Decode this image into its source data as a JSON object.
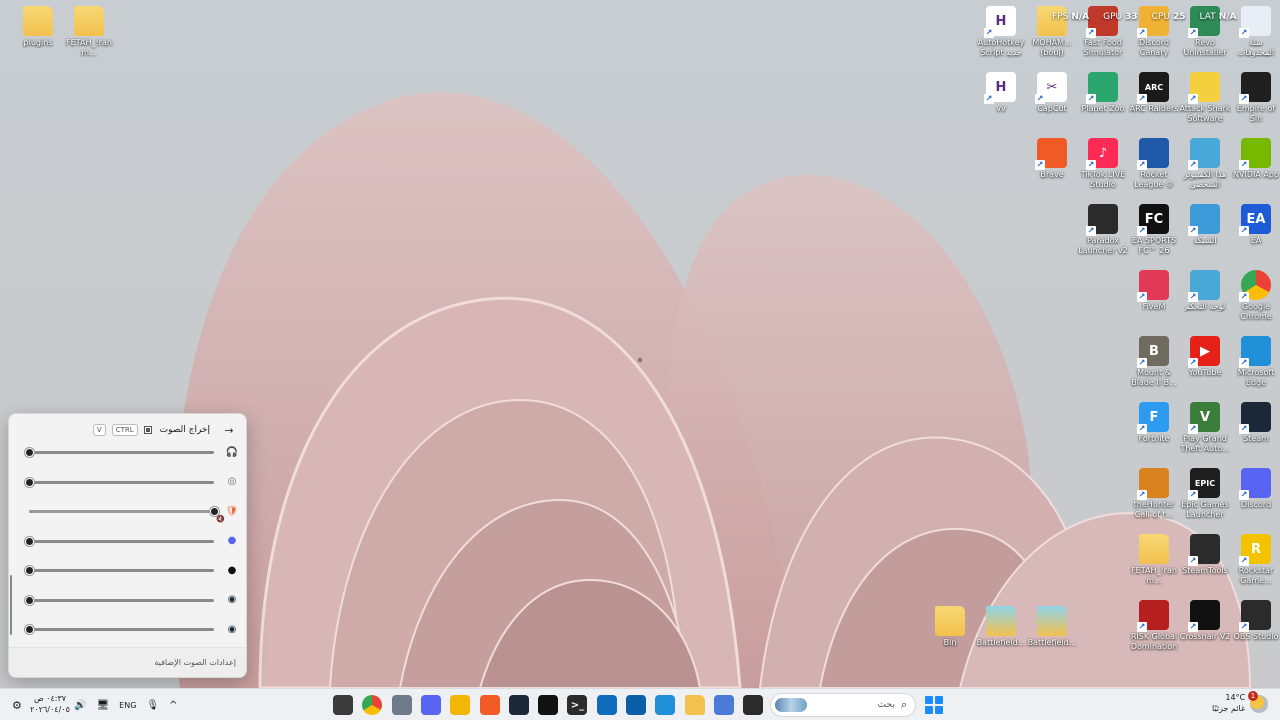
{
  "desktop": {
    "left_icons": [
      {
        "label": "plugins"
      },
      {
        "label": "FETAH_!ranm..."
      }
    ],
    "right_icons": [
      {
        "label": "AutoHotkey Script جديد",
        "glyph": "H",
        "color": "#ffffff"
      },
      {
        "label": "MOHAM... (bouj)",
        "glyph": "",
        "color": "folder"
      },
      {
        "label": "Fast Food Simulator",
        "glyph": "",
        "color": "#c0392b"
      },
      {
        "label": "Discord Canary",
        "glyph": "",
        "color": "#f0b232"
      },
      {
        "label": "Revo Uninstaller",
        "glyph": "",
        "color": "#2e8b57"
      },
      {
        "label": "سلة المحذوفات",
        "glyph": "",
        "color": "#e8eef5"
      },
      {
        "label": "vv",
        "glyph": "H",
        "color": "#ffffff"
      },
      {
        "label": "CapCut",
        "glyph": "✂",
        "color": "#ffffff"
      },
      {
        "label": "Planet Zoo",
        "glyph": "",
        "color": "#2ca66f"
      },
      {
        "label": "ARC Raiders",
        "glyph": "ARC",
        "color": "#1a1a1a"
      },
      {
        "label": "Attack Shark Software",
        "glyph": "",
        "color": "#f4d03f"
      },
      {
        "label": "Empire of Sin",
        "glyph": "",
        "color": "#1f1f1f"
      },
      {
        "label": "Brave",
        "glyph": "",
        "color": "#f15a24"
      },
      {
        "label": "TikTok LIVE Studio",
        "glyph": "♪",
        "color": "#fe2c55"
      },
      {
        "label": "Rocket League ®",
        "glyph": "",
        "color": "#1e5aa8"
      },
      {
        "label": "هذا الكمبيوتر الشخصي",
        "glyph": "",
        "color": "#4aa8d8"
      },
      {
        "label": "NVIDIA App",
        "glyph": "",
        "color": "#76b900"
      },
      {
        "label": "Paradox Launcher v2",
        "glyph": "",
        "color": "#2b2b2b"
      },
      {
        "label": "EA SPORTS FC™ 26",
        "glyph": "FC",
        "color": "#111111"
      },
      {
        "label": "الشبكة",
        "glyph": "",
        "color": "#3c9ad8"
      },
      {
        "label": "EA",
        "glyph": "EA",
        "color": "#1d5cd6"
      },
      {
        "label": "FiveM",
        "glyph": "",
        "color": "#e03a57"
      },
      {
        "label": "لوحة التحكم",
        "glyph": "",
        "color": "#4aa8d8"
      },
      {
        "label": "Google Chrome",
        "glyph": "",
        "color": "chrome"
      },
      {
        "label": "Mount & Blade II B...",
        "glyph": "B",
        "color": "#6f6b5e"
      },
      {
        "label": "YouTube",
        "glyph": "▶",
        "color": "#e62117"
      },
      {
        "label": "Microsoft Edge",
        "glyph": "",
        "color": "#1f8fd8"
      },
      {
        "label": "Fortnite",
        "glyph": "F",
        "color": "#2d9bf0"
      },
      {
        "label": "Play Grand Theft Auto...",
        "glyph": "V",
        "color": "#3b7d3a"
      },
      {
        "label": "Steam",
        "glyph": "",
        "color": "#1b2838"
      },
      {
        "label": "theHunter Call of t...",
        "glyph": "",
        "color": "#d9821e"
      },
      {
        "label": "Epic Games Launcher",
        "glyph": "EPIC",
        "color": "#1e1e1e"
      },
      {
        "label": "Discord",
        "glyph": "",
        "color": "#5865f2"
      },
      {
        "label": "FETAH_!ranm...",
        "glyph": "",
        "color": "folder"
      },
      {
        "label": "SteamTools",
        "glyph": "",
        "color": "#2b2b2b"
      },
      {
        "label": "Rockstar Game...",
        "glyph": "R",
        "color": "#f4c300"
      },
      {
        "label": "RISK Global Domination",
        "glyph": "",
        "color": "#b51f1f"
      },
      {
        "label": "Crosshair V2",
        "glyph": "",
        "color": "#111111"
      },
      {
        "label": "OBS Studio",
        "glyph": "",
        "color": "#2b2b2b"
      }
    ],
    "bottom_icons": [
      {
        "label": "Bin"
      },
      {
        "label": "Battlefield..."
      },
      {
        "label": "Battlefield..."
      }
    ]
  },
  "perf_overlay": {
    "fps_label": "FPS",
    "fps_value": "N/A",
    "gpu_label": "GPU",
    "gpu_value": "33",
    "cpu_label": "CPU",
    "cpu_value": "25",
    "lat_label": "LAT",
    "lat_value": "N/A"
  },
  "volume_mixer": {
    "title": "إخراج الصوت",
    "shortcut_ctrl": "CTRL",
    "shortcut_key": "V",
    "rows": [
      {
        "icon": "headphones-icon",
        "level": 0.0
      },
      {
        "icon": "system-sounds-icon",
        "level": 0.0
      },
      {
        "icon": "brave-icon",
        "level": 1.0,
        "muted": true
      },
      {
        "icon": "discord-icon",
        "level": 0.0
      },
      {
        "icon": "app-icon",
        "level": 0.0
      },
      {
        "icon": "steam-icon",
        "level": 0.0
      },
      {
        "icon": "steam-icon",
        "level": 0.0
      }
    ],
    "footer_link": "إعدادات الصوت الإضافية"
  },
  "taskbar": {
    "search_placeholder": "بحث",
    "time": "٠٤:٣٧ ص",
    "date": "٢٠٢٦/٠٤/٠٥",
    "language": "ENG",
    "weather_temp": "14°C",
    "weather_desc": "غائم جزئيًا",
    "notification_count": "1",
    "apps": [
      {
        "name": "app-icon",
        "color": "#3a3a3a"
      },
      {
        "name": "chrome-icon",
        "color": "chrome"
      },
      {
        "name": "app-icon",
        "color": "#6c7a89"
      },
      {
        "name": "discord-icon",
        "color": "#5865f2"
      },
      {
        "name": "app-icon",
        "color": "#f2b705"
      },
      {
        "name": "brave-icon",
        "color": "#f15a24"
      },
      {
        "name": "steam-icon",
        "color": "#1b2838"
      },
      {
        "name": "app-icon",
        "color": "#111111"
      },
      {
        "name": "terminal-icon",
        "color": "#2b2b2b"
      },
      {
        "name": "app-icon",
        "color": "#0f6cbd"
      },
      {
        "name": "app-icon",
        "color": "#0a5fa8"
      },
      {
        "name": "edge-icon",
        "color": "#1f8fd8"
      },
      {
        "name": "file-explorer-icon",
        "color": "#f2c14e"
      },
      {
        "name": "app-icon",
        "color": "#4b7bd6"
      },
      {
        "name": "app-icon",
        "color": "#2b2b2b"
      }
    ]
  }
}
